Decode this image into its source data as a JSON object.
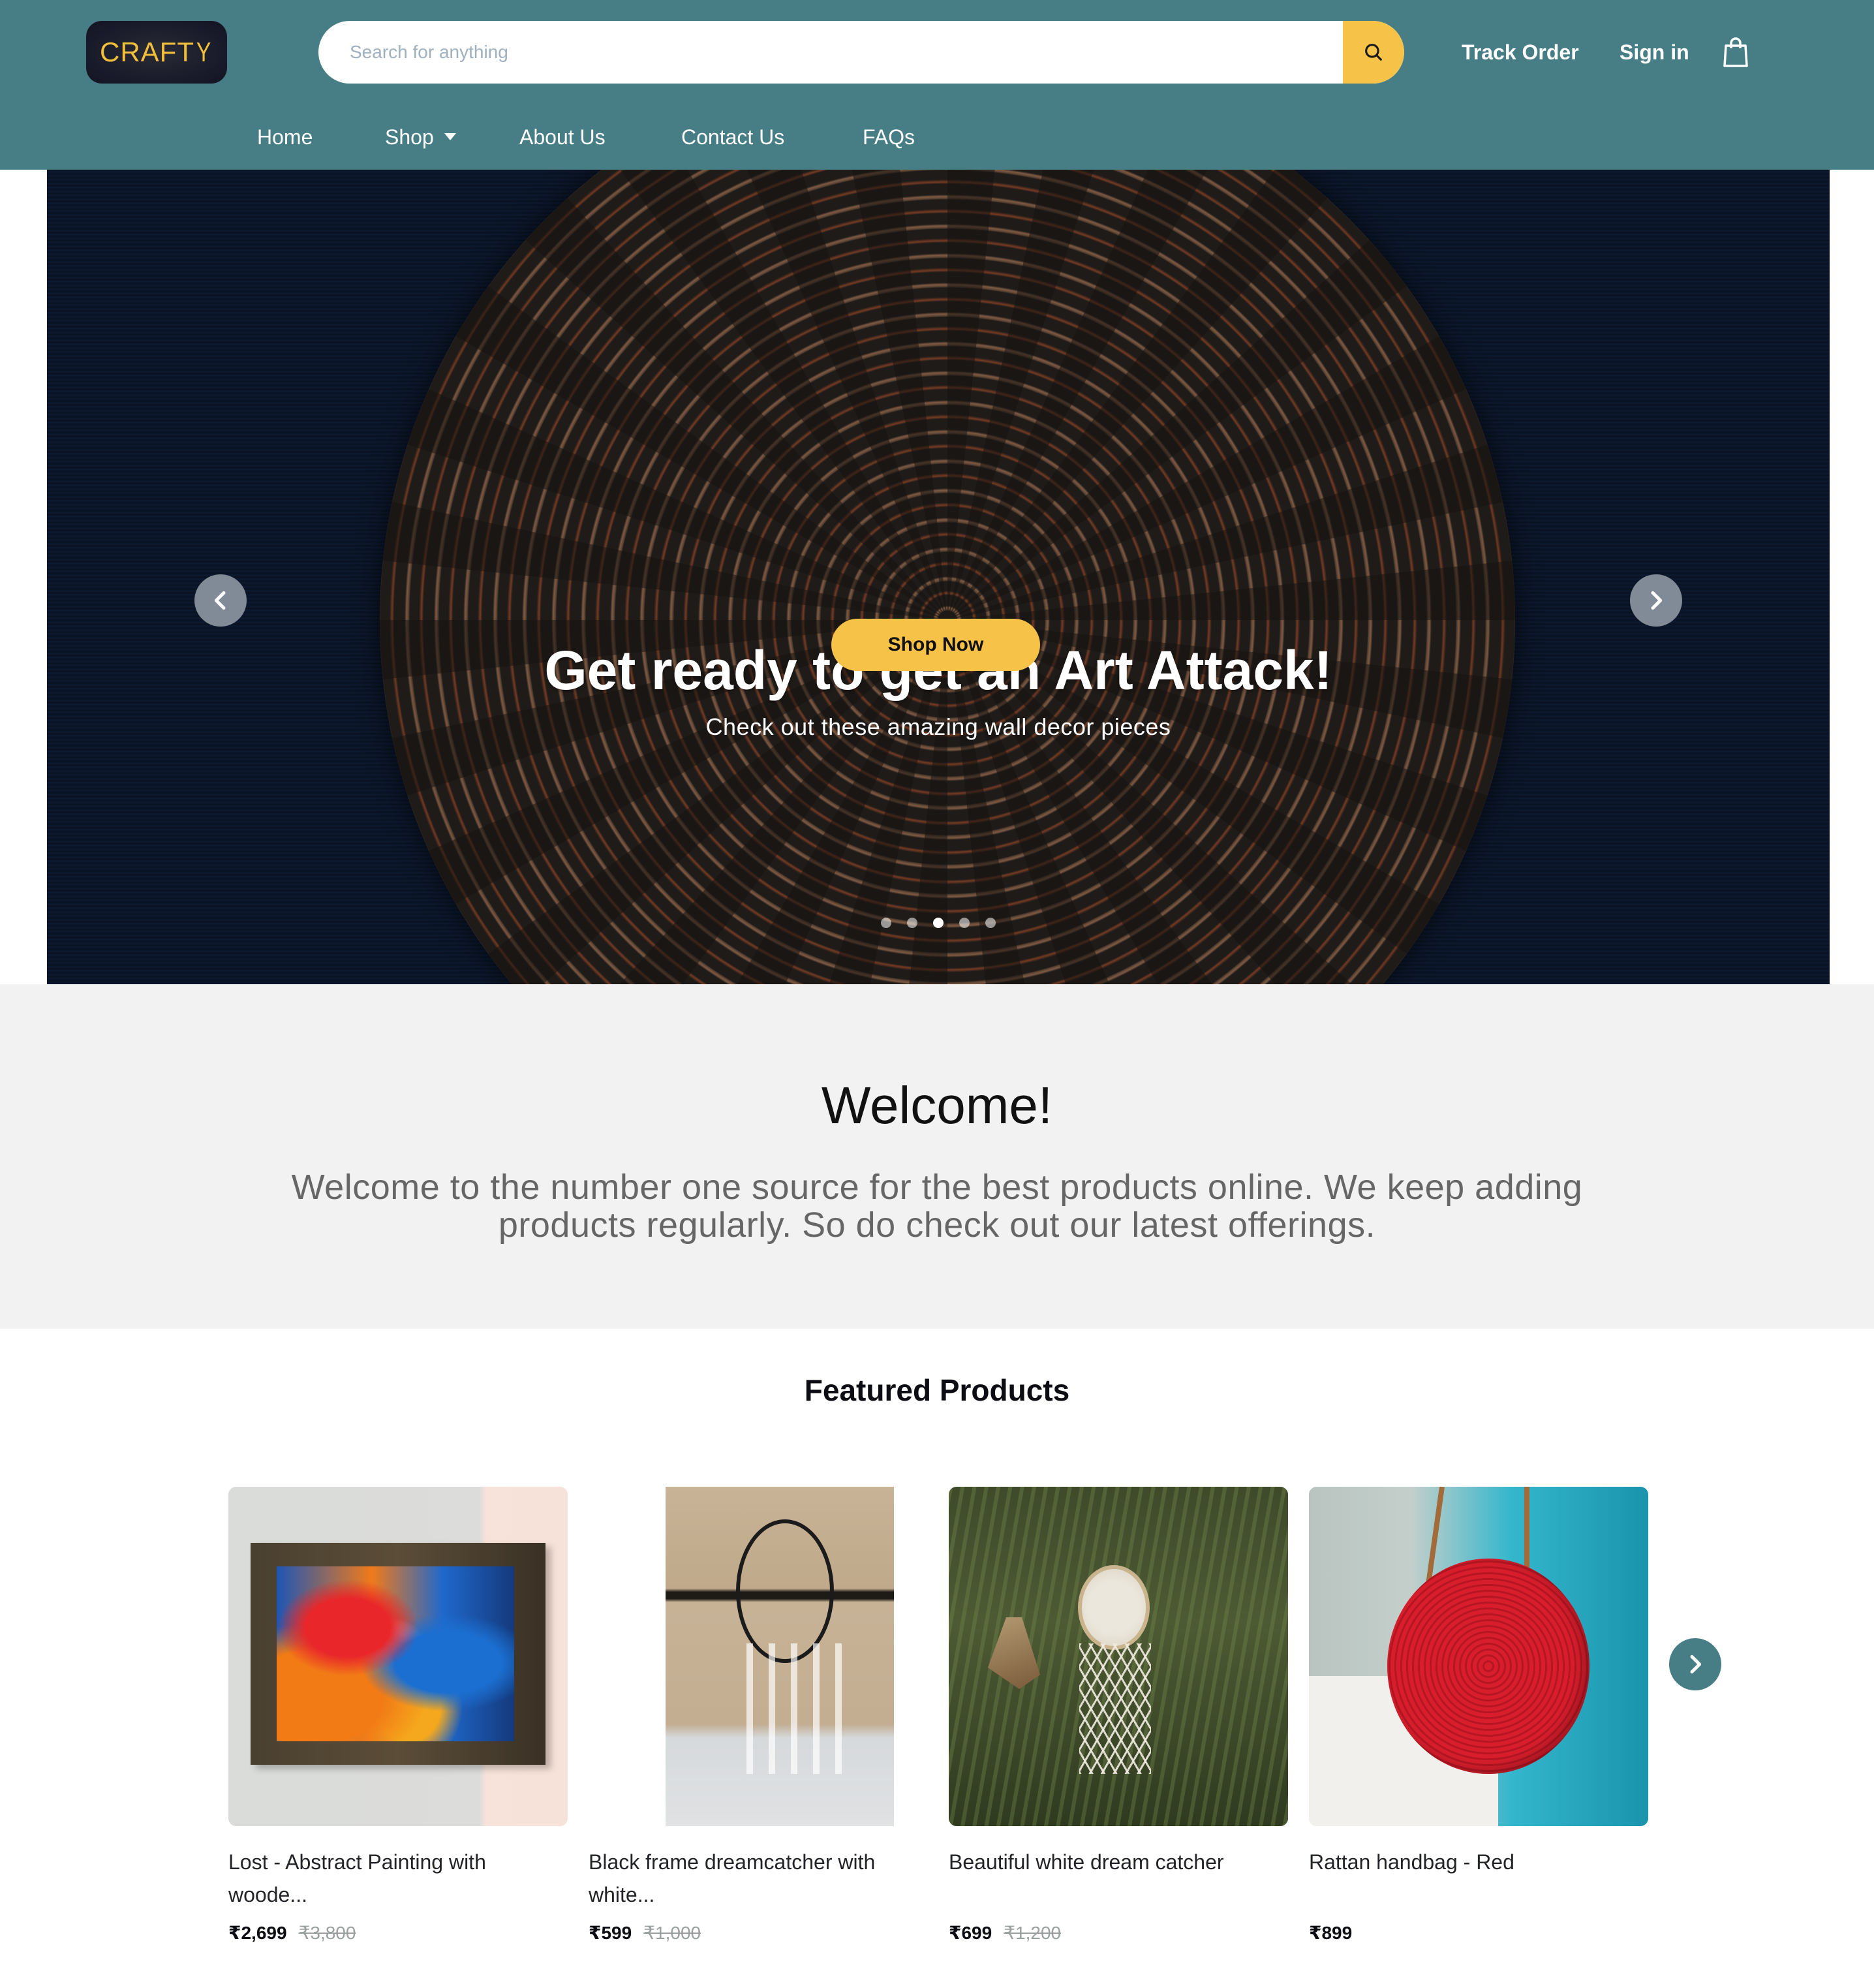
{
  "brand": {
    "logo_text_main": "CRAFT",
    "logo_text_end": "Y",
    "accent_color": "#F6C247",
    "header_color": "#477E85"
  },
  "search": {
    "placeholder": "Search for anything",
    "value": "",
    "button_icon": "search-icon"
  },
  "header_links": {
    "track_order": "Track Order",
    "sign_in": "Sign in",
    "cart_icon": "shopping-bag-icon"
  },
  "nav": {
    "items": [
      {
        "label": "Home"
      },
      {
        "label": "Shop",
        "has_dropdown": true
      },
      {
        "label": "About Us"
      },
      {
        "label": "Contact Us"
      },
      {
        "label": "FAQs"
      }
    ]
  },
  "hero": {
    "title": "Get ready to get an Art Attack!",
    "subtitle": "Check out these amazing wall decor pieces",
    "cta_label": "Shop Now",
    "prev_icon": "chevron-left-icon",
    "next_icon": "chevron-right-icon",
    "slide_count": 5,
    "active_slide": 3
  },
  "welcome": {
    "heading": "Welcome!",
    "text": "Welcome to the number one source for the best products online. We keep adding products regularly. So do check out our latest offerings."
  },
  "featured": {
    "heading": "Featured Products",
    "next_icon": "chevron-right-icon",
    "products": [
      {
        "title": "Lost - Abstract Painting with woode...",
        "price": "₹2,699",
        "mrp": "₹3,800"
      },
      {
        "title": "Black frame dreamcatcher with white...",
        "price": "₹599",
        "mrp": "₹1,000"
      },
      {
        "title": "Beautiful white dream catcher",
        "price": "₹699",
        "mrp": "₹1,200"
      },
      {
        "title": "Rattan handbag - Red",
        "price": "₹899",
        "mrp": ""
      }
    ]
  }
}
